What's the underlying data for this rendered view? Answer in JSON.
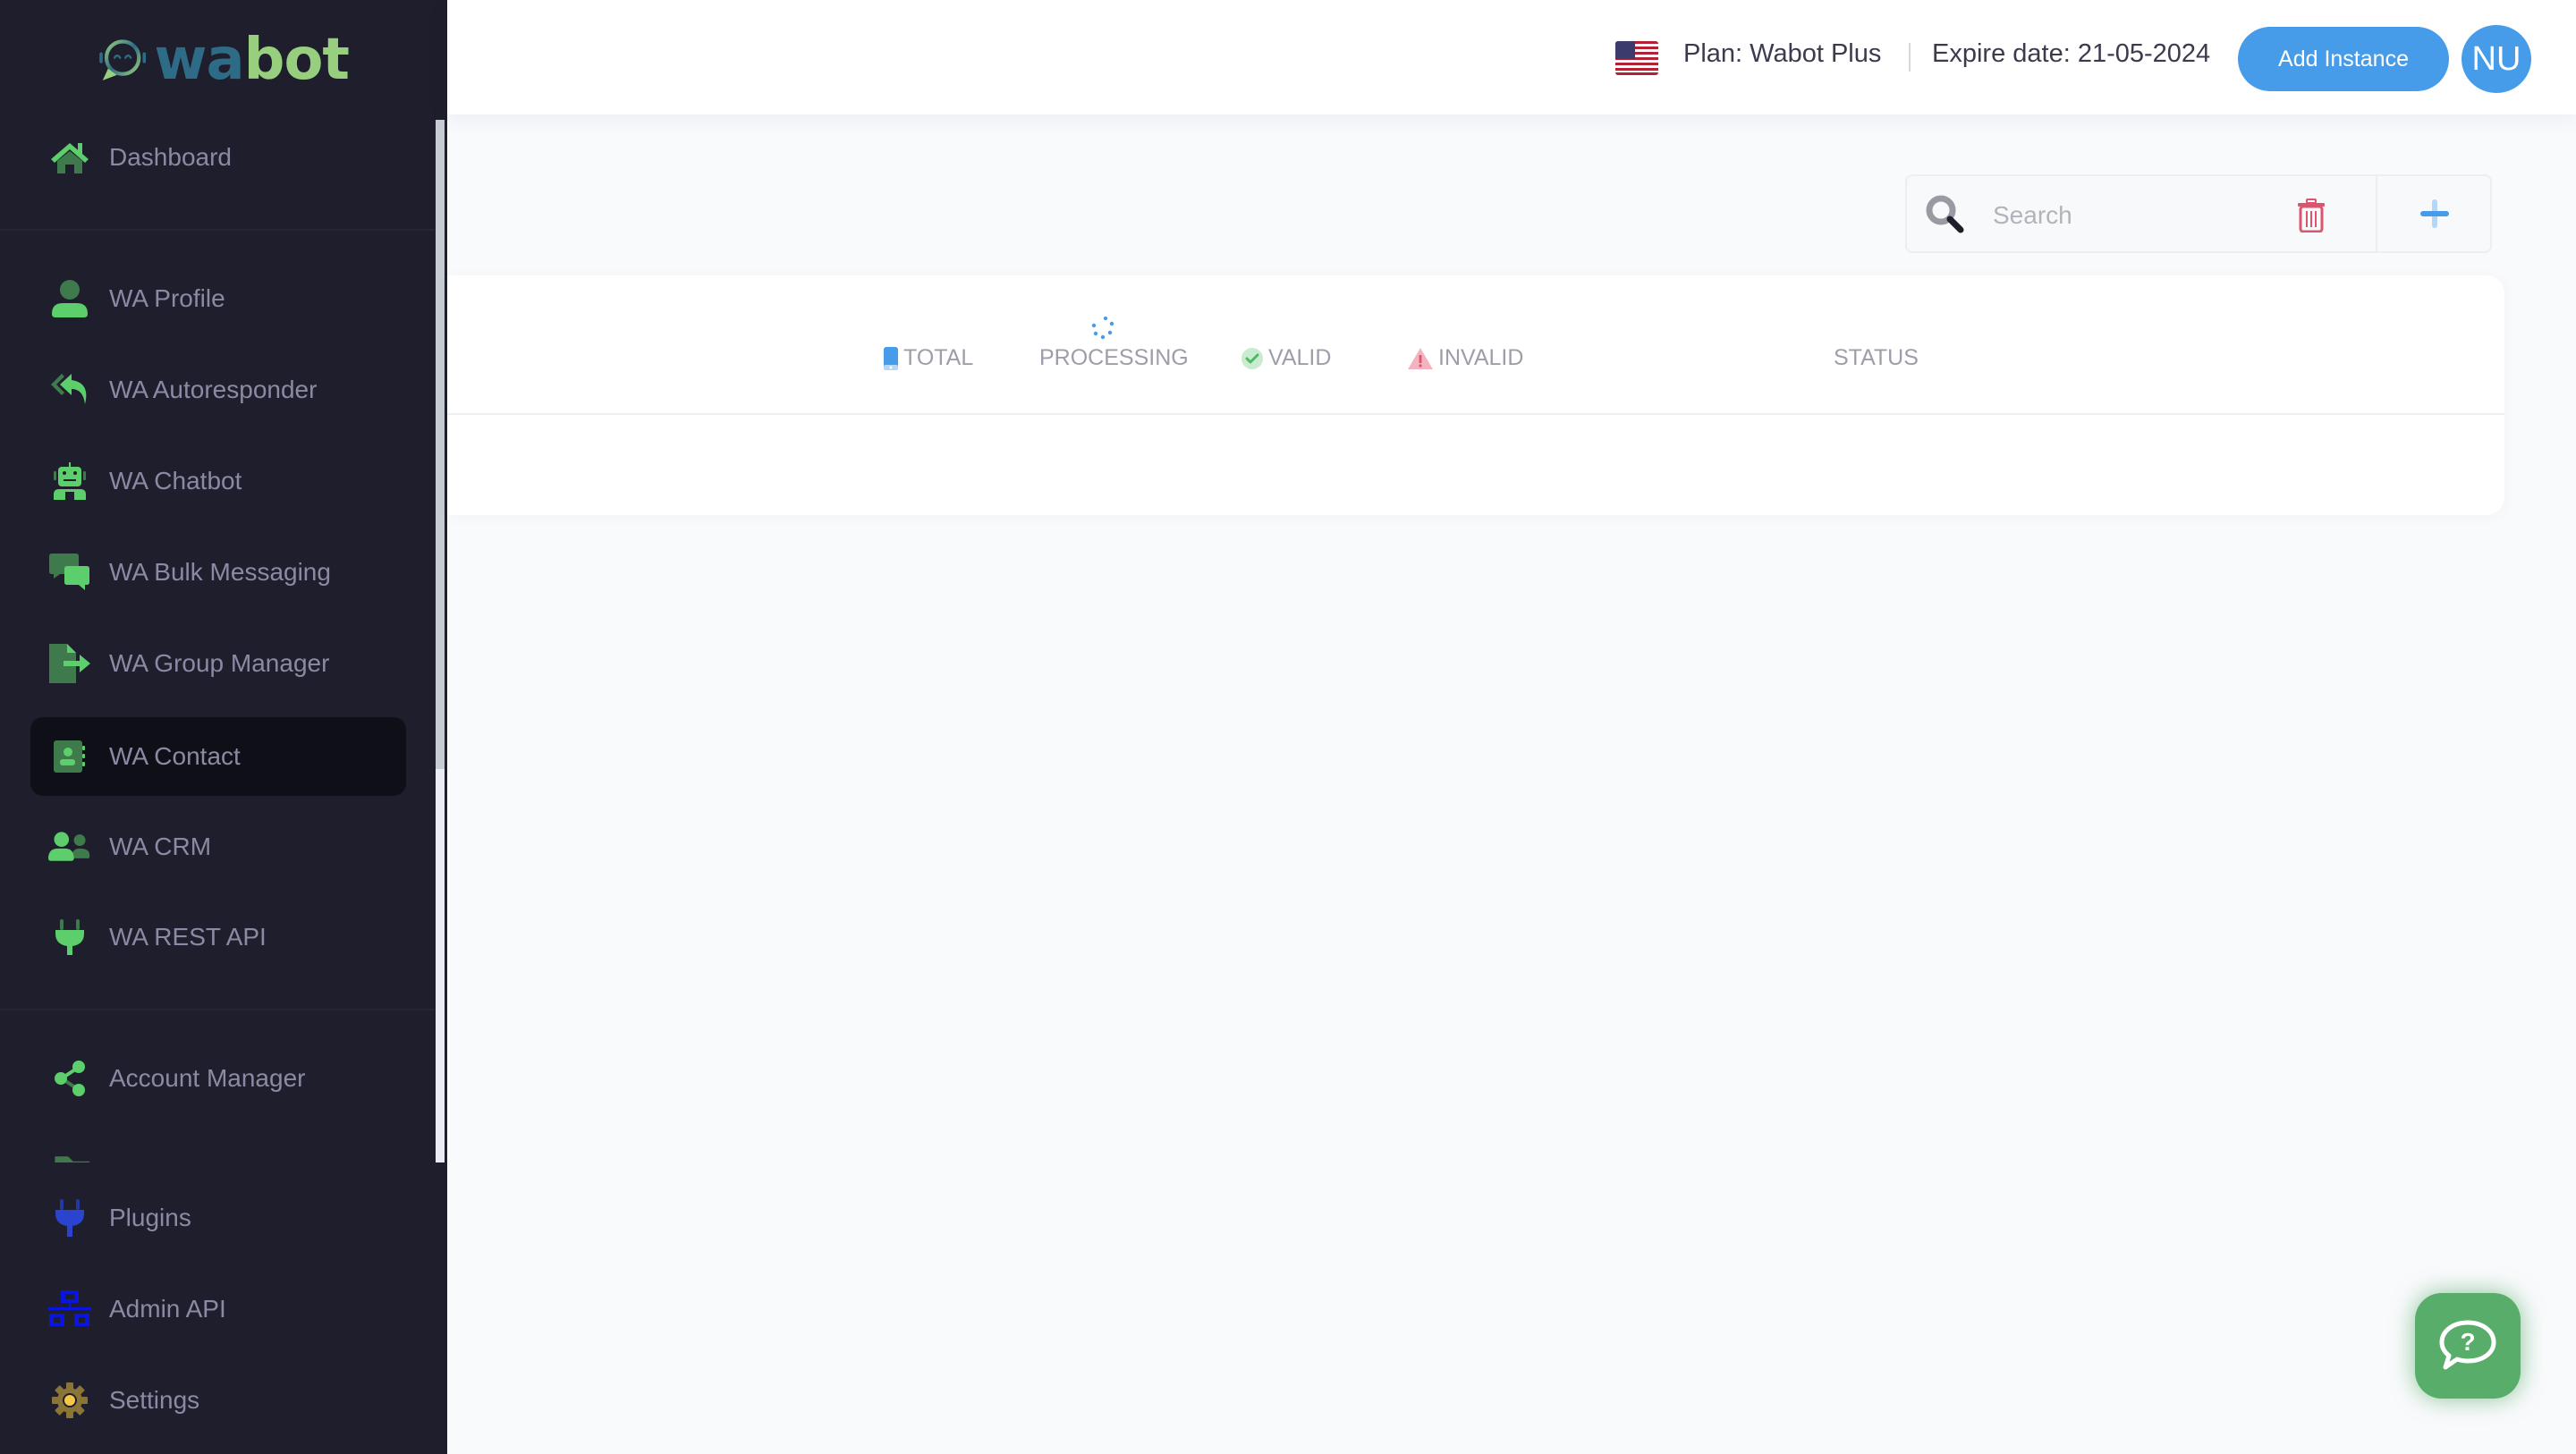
{
  "brand": {
    "name_part1": "wa",
    "name_part2": "bot"
  },
  "sidebar": {
    "active_item": "WA Contact",
    "items": [
      {
        "label": "Dashboard",
        "icon": "home-icon"
      },
      {
        "label": "WA Profile",
        "icon": "user-icon"
      },
      {
        "label": "WA Autoresponder",
        "icon": "reply-all-icon"
      },
      {
        "label": "WA Chatbot",
        "icon": "robot-icon"
      },
      {
        "label": "WA Bulk Messaging",
        "icon": "chat-bubbles-icon"
      },
      {
        "label": "WA Group Manager",
        "icon": "file-export-icon"
      },
      {
        "label": "WA Contact",
        "icon": "address-book-icon"
      },
      {
        "label": "WA CRM",
        "icon": "users-icon"
      },
      {
        "label": "WA REST API",
        "icon": "plug-icon"
      },
      {
        "label": "Account Manager",
        "icon": "share-nodes-icon"
      },
      {
        "label": "Plugins",
        "icon": "plug-icon"
      },
      {
        "label": "Admin API",
        "icon": "network-icon"
      },
      {
        "label": "Settings",
        "icon": "gear-icon"
      }
    ]
  },
  "header": {
    "flag": "us-flag-icon",
    "plan": "Plan: Wabot Plus",
    "expire": "Expire date: 21-05-2024",
    "add_instance_label": "Add Instance",
    "avatar_initials": "NU"
  },
  "search": {
    "placeholder": "Search",
    "value": ""
  },
  "table": {
    "columns": [
      {
        "label": "TOTAL",
        "icon": "mobile-icon"
      },
      {
        "label": "PROCESSING",
        "icon": "spinner-icon"
      },
      {
        "label": "VALID",
        "icon": "check-circle-icon"
      },
      {
        "label": "INVALID",
        "icon": "warning-icon"
      },
      {
        "label": "STATUS",
        "icon": ""
      }
    ],
    "rows": []
  },
  "colors": {
    "sidebar_bg": "#1f1e2c",
    "accent_green": "#5ccf6c",
    "accent_blue": "#469ce8",
    "danger": "#d9566e",
    "help_green": "#58ad6a"
  }
}
